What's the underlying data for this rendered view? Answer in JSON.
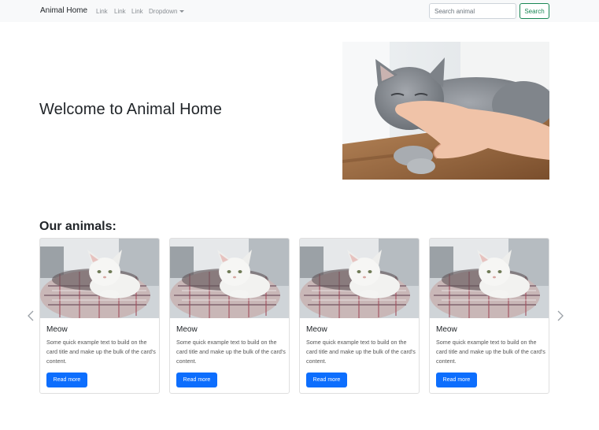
{
  "navbar": {
    "brand": "Animal Home",
    "links": [
      "Link",
      "Link",
      "Link"
    ],
    "dropdown_label": "Dropdown",
    "search_placeholder": "Search animal",
    "search_button": "Search"
  },
  "hero": {
    "title": "Welcome to Animal Home",
    "image_icon": "gray-cat-photo"
  },
  "animals_section": {
    "title": "Our animals:",
    "cards": [
      {
        "title": "Meow",
        "text": "Some quick example text to build on the card title and make up the bulk of the card's content.",
        "button": "Read more"
      },
      {
        "title": "Meow",
        "text": "Some quick example text to build on the card title and make up the bulk of the card's content.",
        "button": "Read more"
      },
      {
        "title": "Meow",
        "text": "Some quick example text to build on the card title and make up the bulk of the card's content.",
        "button": "Read more"
      },
      {
        "title": "Meow",
        "text": "Some quick example text to build on the card title and make up the bulk of the card's content.",
        "button": "Read more"
      }
    ],
    "prev_icon": "chevron-left-icon",
    "next_icon": "chevron-right-icon"
  },
  "colors": {
    "navbar_bg": "#f8f9fa",
    "primary": "#0d6efd",
    "success": "#198754"
  }
}
